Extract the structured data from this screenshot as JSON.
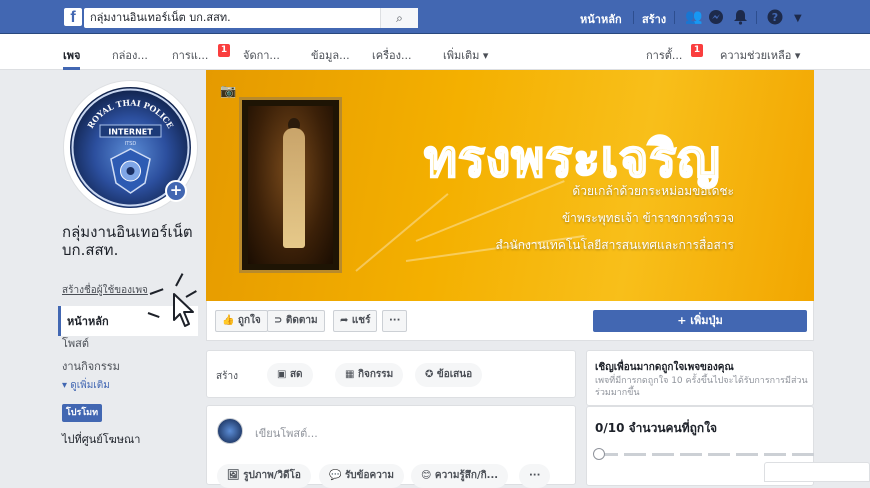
{
  "topbar": {
    "search_value": "กลุ่มงานอินเทอร์เน็ต บก.สสท.",
    "home_label": "หน้าหลัก",
    "create_label": "สร้าง",
    "brand_color": "#4267b2"
  },
  "pagenav": {
    "tabs": [
      "เพจ",
      "กล่อง...",
      "การแ...",
      "จัดกา...",
      "ข้อมูล...",
      "เครื่อง...",
      "เพิ่มเติม ▾"
    ],
    "badge1": "1",
    "badge2": "1",
    "settings_label": "การตั้...",
    "help_label": "ความช่วยเหลือ ▾"
  },
  "profile": {
    "name": "กลุ่มงานอินเทอร์เน็ต บก.สสท.",
    "username_link": "สร้างชื่อผู้ใช้ของเพจ",
    "avatar_text_top": "ROYAL THAI POLICE",
    "avatar_text_mid": "INTERNET",
    "avatar_text_sub": "ITSD"
  },
  "leftnav": {
    "home": "หน้าหลัก",
    "posts": "โพสต์",
    "events": "งานกิจกรรม",
    "see_more": "▾ ดูเพิ่มเติม",
    "promote": "โปรโมท",
    "ads_center": "ไปที่ศูนย์โฆษณา"
  },
  "cover": {
    "title": "ทรงพระเจริญ",
    "line1": "ด้วยเกล้าด้วยกระหม่อมขอเดชะ",
    "line2": "ข้าพระพุทธเจ้า ข้าราชการตำรวจ",
    "line3": "สำนักงานเทคโนโลยีสารสนเทศและการสื่อสาร"
  },
  "actions": {
    "like": "👍 ถูกใจ",
    "follow": "ติดตาม",
    "share": "➦ แชร์",
    "more": "···",
    "add_button": "+ เพิ่มปุ่ม"
  },
  "create": {
    "label": "สร้าง",
    "live": "สด",
    "event": "กิจกรรม",
    "offer": "ข้อเสนอ"
  },
  "composer": {
    "placeholder": "เขียนโพสต์...",
    "photo": "รูปภาพ/วิดีโอ",
    "message": "รับข้อความ",
    "feeling": "ความรู้สึก/กิ...",
    "more": "···"
  },
  "invite": {
    "title": "เชิญเพื่อนมากดถูกใจเพจของคุณ",
    "desc": "เพจที่มีการกดถูกใจ 10 ครั้งขึ้นไปจะได้รับการการมีส่วนร่วมมากขึ้น"
  },
  "likes": {
    "title": "0/10 จำนวนคนที่ถูกใจ",
    "progress": 0
  }
}
